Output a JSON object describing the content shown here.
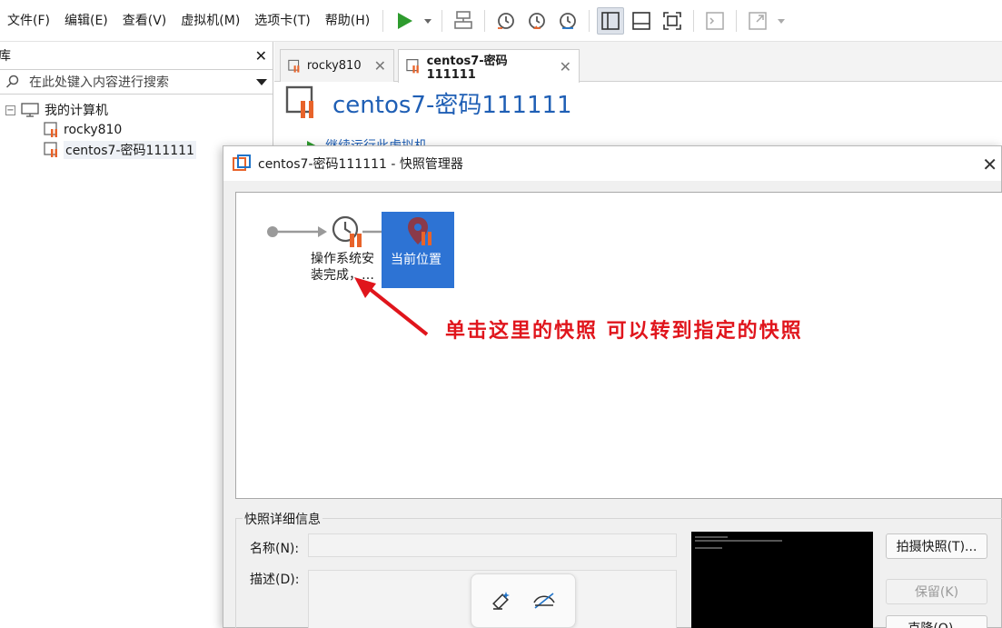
{
  "menu": {
    "file": "文件(F)",
    "edit": "编辑(E)",
    "view": "查看(V)",
    "vm": "虚拟机(M)",
    "tabs": "选项卡(T)",
    "help": "帮助(H)"
  },
  "toolbar": {
    "icons": [
      "play-icon",
      "dropdown-arrow-icon",
      "send-keys-icon",
      "take-snapshot-icon",
      "revert-snapshot-icon",
      "snapshot-manager-icon",
      "library-view-icon",
      "console-view-icon",
      "fullscreen-icon",
      "terminal-icon",
      "stretch-icon"
    ],
    "play_color": "#2e9b2e"
  },
  "library": {
    "title": "库",
    "search_placeholder": "在此处键入内容进行搜索",
    "root": "我的计算机",
    "vms": [
      "rocky810",
      "centos7-密码111111"
    ]
  },
  "tabs": [
    {
      "label": "rocky810",
      "active": false
    },
    {
      "label": "centos7-密码111111",
      "active": true
    }
  ],
  "vm_page": {
    "title": "centos7-密码111111",
    "continue_action": "继续运行此虚拟机"
  },
  "dialog": {
    "title": "centos7-密码111111 - 快照管理器",
    "snapshot_name_line1": "操作系统安",
    "snapshot_name_line2": "装完成，…",
    "current_position": "当前位置",
    "annotation": "单击这里的快照  可以转到指定的快照",
    "details_title": "快照详细信息",
    "name_label": "名称(N):",
    "description_label": "描述(D):",
    "take_snapshot": "拍摄快照(T)...",
    "keep": "保留(K)",
    "clone": "克隆(O)..."
  },
  "colors": {
    "accent_blue": "#1f5fb5",
    "selection_blue": "#2d73d4",
    "annotation_red": "#e0151c",
    "vm_icon_orange": "#e8632a"
  }
}
